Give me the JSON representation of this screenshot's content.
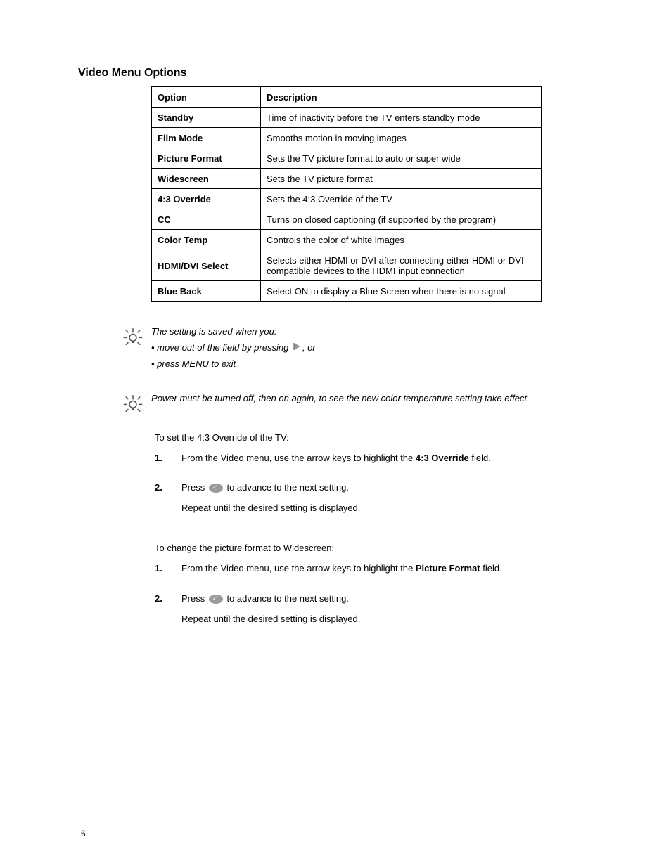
{
  "section_title": "Video Menu Options",
  "table": {
    "headers": [
      "Option",
      "Description"
    ],
    "rows": [
      [
        "Standby",
        "Time of inactivity before the TV enters standby mode"
      ],
      [
        "Film Mode",
        "Smooths motion in moving images"
      ],
      [
        "Picture Format",
        "Sets the TV picture format to auto or super wide"
      ],
      [
        "Widescreen",
        "Sets the TV picture format"
      ],
      [
        "4:3 Override",
        "Sets the 4:3 Override of the TV"
      ],
      [
        "CC",
        "Turns on closed captioning (if supported by the program)"
      ],
      [
        "Color Temp",
        "Controls the color of white images"
      ],
      [
        "HDMI/DVI Select",
        "Selects either HDMI or DVI after connecting either HDMI or DVI compatible devices to the HDMI input connection"
      ],
      [
        "Blue Back",
        "Select ON to display a Blue Screen when there is no signal"
      ]
    ]
  },
  "tip1": {
    "line1": "The setting is saved when you:",
    "line2_pre": "• move out of the field by pressing ",
    "line2_post": ", or",
    "line3": "• press MENU to exit",
    "icon_alt": "right-arrow"
  },
  "tip2": "Power must be turned off, then on again, to see the new color temperature setting take effect.",
  "steps1": {
    "intro": "To set the 4:3 Override of the TV:",
    "s1a": "From the Video menu, use the arrow keys to highlight the ",
    "s1b": "4:3 Override",
    "s1c": " field.",
    "s2a": "Press ",
    "s2b": " to advance to the next setting.",
    "s2c": "Repeat until the desired setting is displayed.",
    "icon_alt": "ok-button"
  },
  "steps2": {
    "intro": "To change the picture format to Widescreen:",
    "s1a": "From the Video menu, use the arrow keys to highlight the ",
    "s1b": "Picture Format",
    "s1c": " field.",
    "s2a": "Press ",
    "s2b": " to advance to the next setting.",
    "s2c": "Repeat until the desired setting is displayed.",
    "icon_alt": "ok-button"
  },
  "footer": "6"
}
